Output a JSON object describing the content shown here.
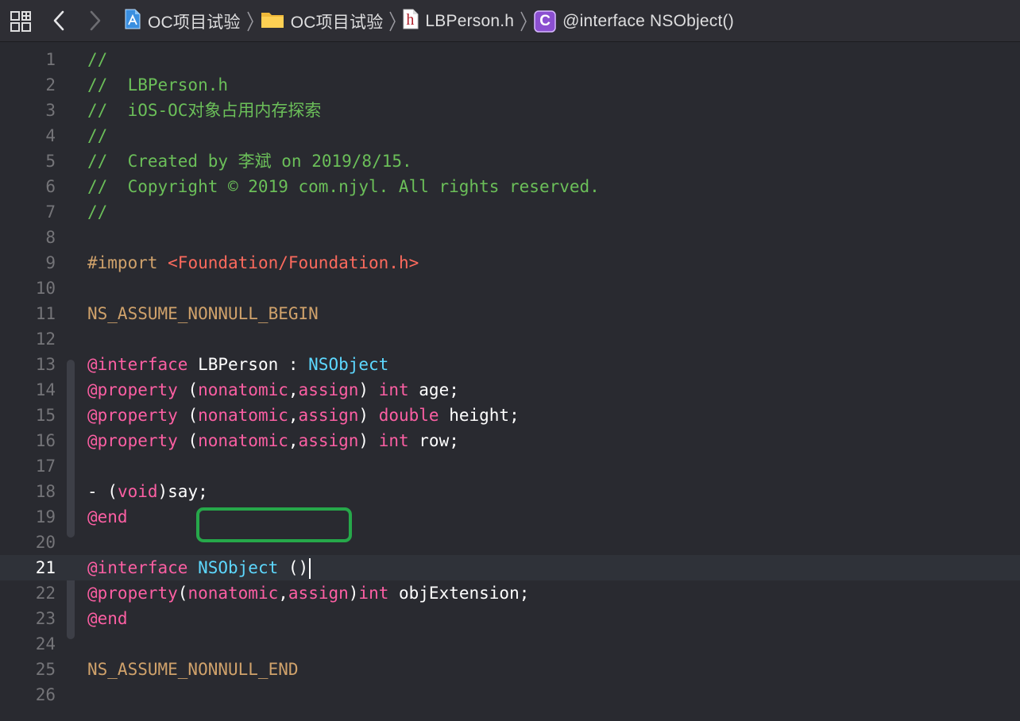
{
  "jumpbar": {
    "crumbs": [
      {
        "label": "OC项目试验",
        "icon": "xcode-project-icon"
      },
      {
        "label": "OC项目试验",
        "icon": "folder-icon"
      },
      {
        "label": "LBPerson.h",
        "icon": "header-file-icon"
      },
      {
        "label": "@interface NSObject()",
        "icon": "class-c-icon"
      }
    ],
    "class_icon_letter": "C",
    "header_icon_letter": "h"
  },
  "editor": {
    "current_line": 21,
    "lines": [
      {
        "n": "1",
        "tokens": [
          {
            "t": "//",
            "c": "comment"
          }
        ]
      },
      {
        "n": "2",
        "tokens": [
          {
            "t": "//  LBPerson.h",
            "c": "comment"
          }
        ]
      },
      {
        "n": "3",
        "tokens": [
          {
            "t": "//  iOS-OC对象占用内存探索",
            "c": "comment"
          }
        ]
      },
      {
        "n": "4",
        "tokens": [
          {
            "t": "//",
            "c": "comment"
          }
        ]
      },
      {
        "n": "5",
        "tokens": [
          {
            "t": "//  Created by 李斌 on 2019/8/15.",
            "c": "comment"
          }
        ]
      },
      {
        "n": "6",
        "tokens": [
          {
            "t": "//  Copyright © 2019 com.njyl. All rights reserved.",
            "c": "comment"
          }
        ]
      },
      {
        "n": "7",
        "tokens": [
          {
            "t": "//",
            "c": "comment"
          }
        ]
      },
      {
        "n": "8",
        "tokens": []
      },
      {
        "n": "9",
        "tokens": [
          {
            "t": "#import ",
            "c": "pre2"
          },
          {
            "t": "<Foundation/Foundation.h>",
            "c": "str"
          }
        ]
      },
      {
        "n": "10",
        "tokens": []
      },
      {
        "n": "11",
        "tokens": [
          {
            "t": "NS_ASSUME_NONNULL_BEGIN",
            "c": "pre2"
          }
        ]
      },
      {
        "n": "12",
        "tokens": []
      },
      {
        "n": "13",
        "tokens": [
          {
            "t": "@interface",
            "c": "kw"
          },
          {
            "t": " LBPerson : ",
            "c": "plain"
          },
          {
            "t": "NSObject",
            "c": "type"
          }
        ]
      },
      {
        "n": "14",
        "tokens": [
          {
            "t": "@property",
            "c": "kw"
          },
          {
            "t": " (",
            "c": "plain"
          },
          {
            "t": "nonatomic",
            "c": "kw"
          },
          {
            "t": ",",
            "c": "plain"
          },
          {
            "t": "assign",
            "c": "kw"
          },
          {
            "t": ") ",
            "c": "plain"
          },
          {
            "t": "int",
            "c": "kw"
          },
          {
            "t": " age;",
            "c": "plain"
          }
        ]
      },
      {
        "n": "15",
        "tokens": [
          {
            "t": "@property",
            "c": "kw"
          },
          {
            "t": " (",
            "c": "plain"
          },
          {
            "t": "nonatomic",
            "c": "kw"
          },
          {
            "t": ",",
            "c": "plain"
          },
          {
            "t": "assign",
            "c": "kw"
          },
          {
            "t": ") ",
            "c": "plain"
          },
          {
            "t": "double",
            "c": "kw"
          },
          {
            "t": " height;",
            "c": "plain"
          }
        ]
      },
      {
        "n": "16",
        "tokens": [
          {
            "t": "@property",
            "c": "kw"
          },
          {
            "t": " (",
            "c": "plain"
          },
          {
            "t": "nonatomic",
            "c": "kw"
          },
          {
            "t": ",",
            "c": "plain"
          },
          {
            "t": "assign",
            "c": "kw"
          },
          {
            "t": ") ",
            "c": "plain"
          },
          {
            "t": "int",
            "c": "kw"
          },
          {
            "t": " row;",
            "c": "plain"
          }
        ]
      },
      {
        "n": "17",
        "tokens": []
      },
      {
        "n": "18",
        "tokens": [
          {
            "t": "- (",
            "c": "plain"
          },
          {
            "t": "void",
            "c": "kw"
          },
          {
            "t": ")say;",
            "c": "plain"
          }
        ]
      },
      {
        "n": "19",
        "tokens": [
          {
            "t": "@end",
            "c": "kw"
          }
        ]
      },
      {
        "n": "20",
        "tokens": []
      },
      {
        "n": "21",
        "tokens": [
          {
            "t": "@interface",
            "c": "kw"
          },
          {
            "t": " ",
            "c": "plain"
          },
          {
            "t": "NSObject",
            "c": "type"
          },
          {
            "t": " ()",
            "c": "plain"
          }
        ],
        "caret": true
      },
      {
        "n": "22",
        "tokens": [
          {
            "t": "@property",
            "c": "kw"
          },
          {
            "t": "(",
            "c": "plain"
          },
          {
            "t": "nonatomic",
            "c": "kw"
          },
          {
            "t": ",",
            "c": "plain"
          },
          {
            "t": "assign",
            "c": "kw"
          },
          {
            "t": ")",
            "c": "plain"
          },
          {
            "t": "int",
            "c": "kw"
          },
          {
            "t": " objExtension;",
            "c": "plain"
          }
        ]
      },
      {
        "n": "23",
        "tokens": [
          {
            "t": "@end",
            "c": "kw"
          }
        ]
      },
      {
        "n": "24",
        "tokens": []
      },
      {
        "n": "25",
        "tokens": [
          {
            "t": "NS_ASSUME_NONNULL_END",
            "c": "pre2"
          }
        ]
      },
      {
        "n": "26",
        "tokens": []
      }
    ]
  },
  "colors": {
    "background": "#292a30",
    "current_line": "#2f3239",
    "comment": "#6bbf59",
    "keyword": "#fc5fa3",
    "type": "#5dd8ff",
    "string": "#fc6a5d",
    "preprocessor": "#d0a26b",
    "highlight_box": "#26a84a"
  }
}
